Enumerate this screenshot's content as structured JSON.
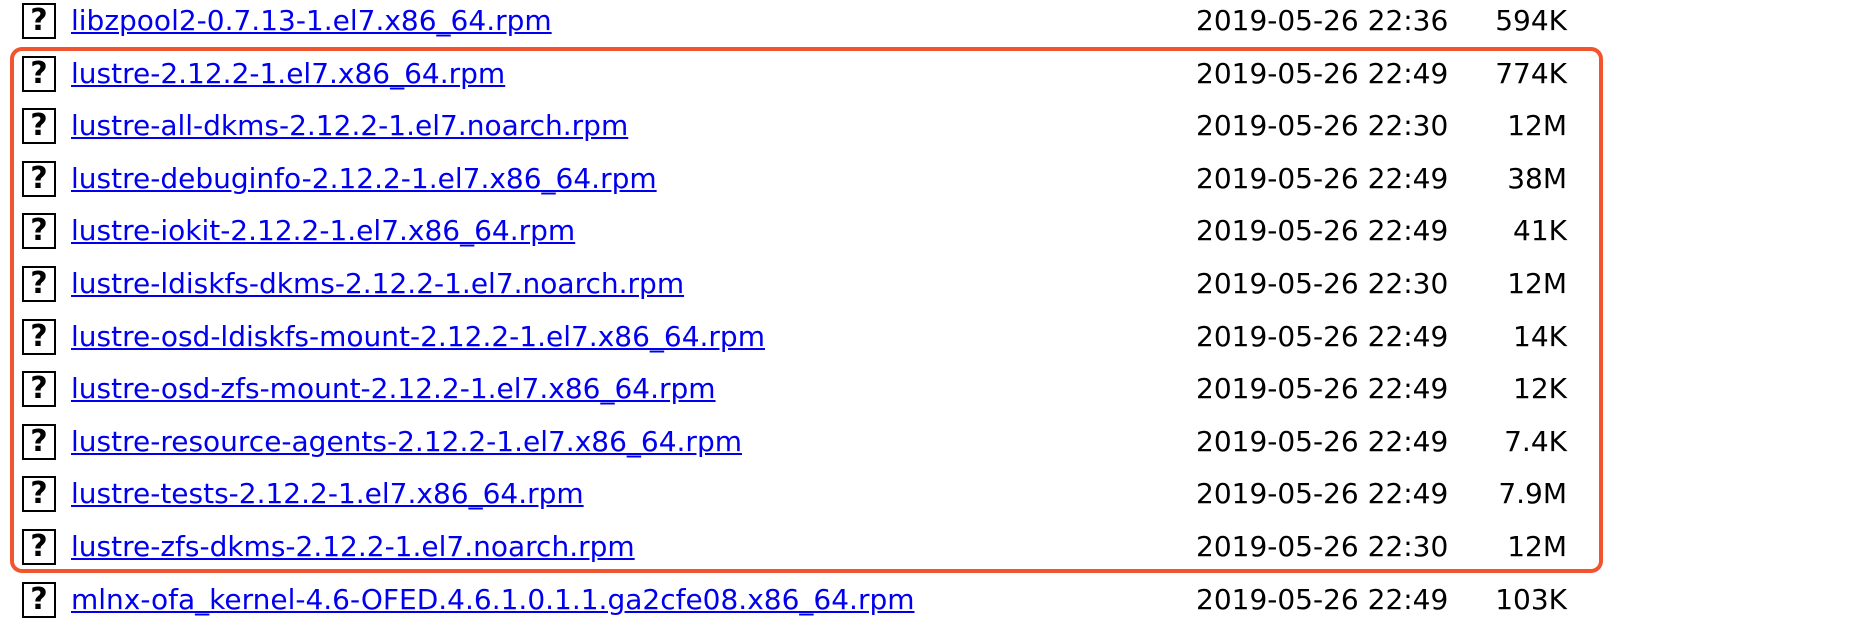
{
  "highlight_color": "#f2542d",
  "link_color": "#0000ee",
  "icon": {
    "name": "unknown-file-icon",
    "glyph": "?"
  },
  "files": [
    {
      "name": "libzpool2-0.7.13-1.el7.x86_64.rpm",
      "date": "2019-05-26 22:36",
      "size": "594K"
    },
    {
      "name": "lustre-2.12.2-1.el7.x86_64.rpm",
      "date": "2019-05-26 22:49",
      "size": "774K"
    },
    {
      "name": "lustre-all-dkms-2.12.2-1.el7.noarch.rpm",
      "date": "2019-05-26 22:30",
      "size": "12M"
    },
    {
      "name": "lustre-debuginfo-2.12.2-1.el7.x86_64.rpm",
      "date": "2019-05-26 22:49",
      "size": "38M"
    },
    {
      "name": "lustre-iokit-2.12.2-1.el7.x86_64.rpm",
      "date": "2019-05-26 22:49",
      "size": "41K"
    },
    {
      "name": "lustre-ldiskfs-dkms-2.12.2-1.el7.noarch.rpm",
      "date": "2019-05-26 22:30",
      "size": "12M"
    },
    {
      "name": "lustre-osd-ldiskfs-mount-2.12.2-1.el7.x86_64.rpm",
      "date": "2019-05-26 22:49",
      "size": "14K"
    },
    {
      "name": "lustre-osd-zfs-mount-2.12.2-1.el7.x86_64.rpm",
      "date": "2019-05-26 22:49",
      "size": "12K"
    },
    {
      "name": "lustre-resource-agents-2.12.2-1.el7.x86_64.rpm",
      "date": "2019-05-26 22:49",
      "size": "7.4K"
    },
    {
      "name": "lustre-tests-2.12.2-1.el7.x86_64.rpm",
      "date": "2019-05-26 22:49",
      "size": "7.9M"
    },
    {
      "name": "lustre-zfs-dkms-2.12.2-1.el7.noarch.rpm",
      "date": "2019-05-26 22:30",
      "size": "12M"
    },
    {
      "name": "mlnx-ofa_kernel-4.6-OFED.4.6.1.0.1.1.ga2cfe08.x86_64.rpm",
      "date": "2019-05-26 22:49",
      "size": "103K"
    }
  ]
}
